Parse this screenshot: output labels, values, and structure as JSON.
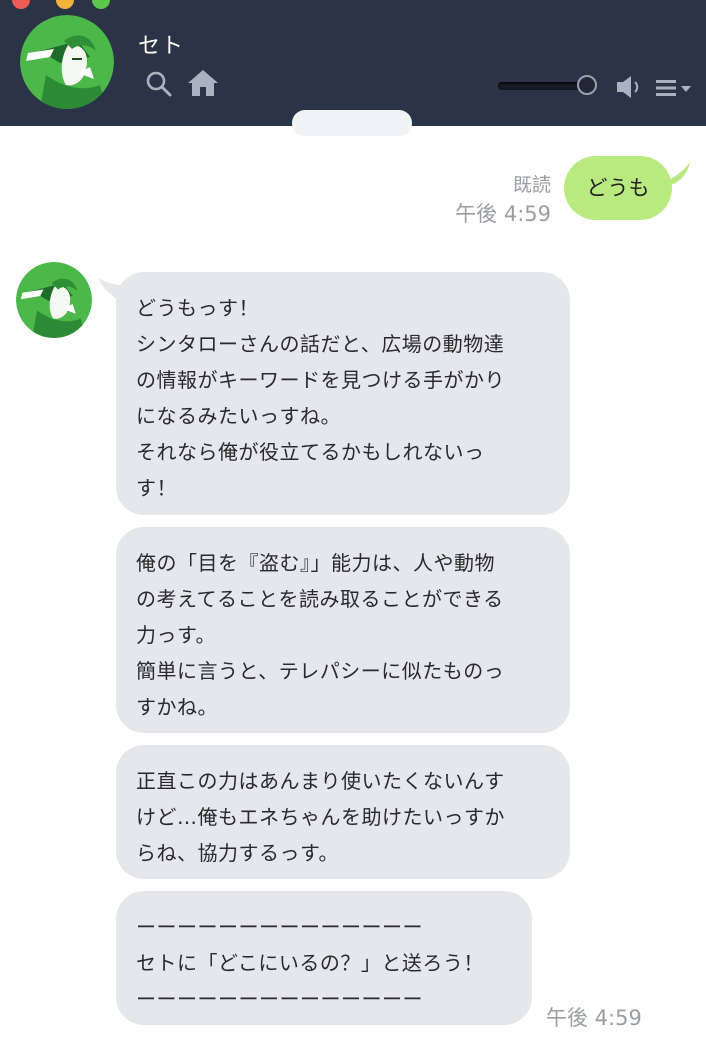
{
  "window": {
    "traffic_light_colors": [
      "#ec5b54",
      "#f2b33d",
      "#5ac84a"
    ]
  },
  "header": {
    "contact_name": "セト",
    "icons": [
      "search-icon",
      "home-icon",
      "volume-icon",
      "menu-icon"
    ],
    "volume_level": 0.9
  },
  "colors": {
    "header_bg": "#2b3346",
    "outgoing_bubble": "#b9ea7f",
    "incoming_bubble": "#e5e7ea",
    "meta_text": "#9a9da3"
  },
  "chat": {
    "outgoing": {
      "text": "どうも",
      "read_label": "既読",
      "time": "午後 4:59"
    },
    "incoming": {
      "messages": [
        "どうもっす！\nシンタローさんの話だと、広場の動物達\nの情報がキーワードを見つける手がかり\nになるみたいっすね。\nそれなら俺が役立てるかもしれないっ\nす！",
        "俺の「目を『盗む』」能力は、人や動物\nの考えてることを読み取ることができる\n力っす。\n簡単に言うと、テレパシーに似たものっ\nすかね。",
        "正直この力はあんまり使いたくないんす\nけど…俺もエネちゃんを助けたいっすか\nらね、協力するっす。",
        "ーーーーーーーーーーーーーー\nセトに「どこにいるの？」と送ろう！\nーーーーーーーーーーーーーー"
      ],
      "time": "午後 4:59"
    }
  }
}
